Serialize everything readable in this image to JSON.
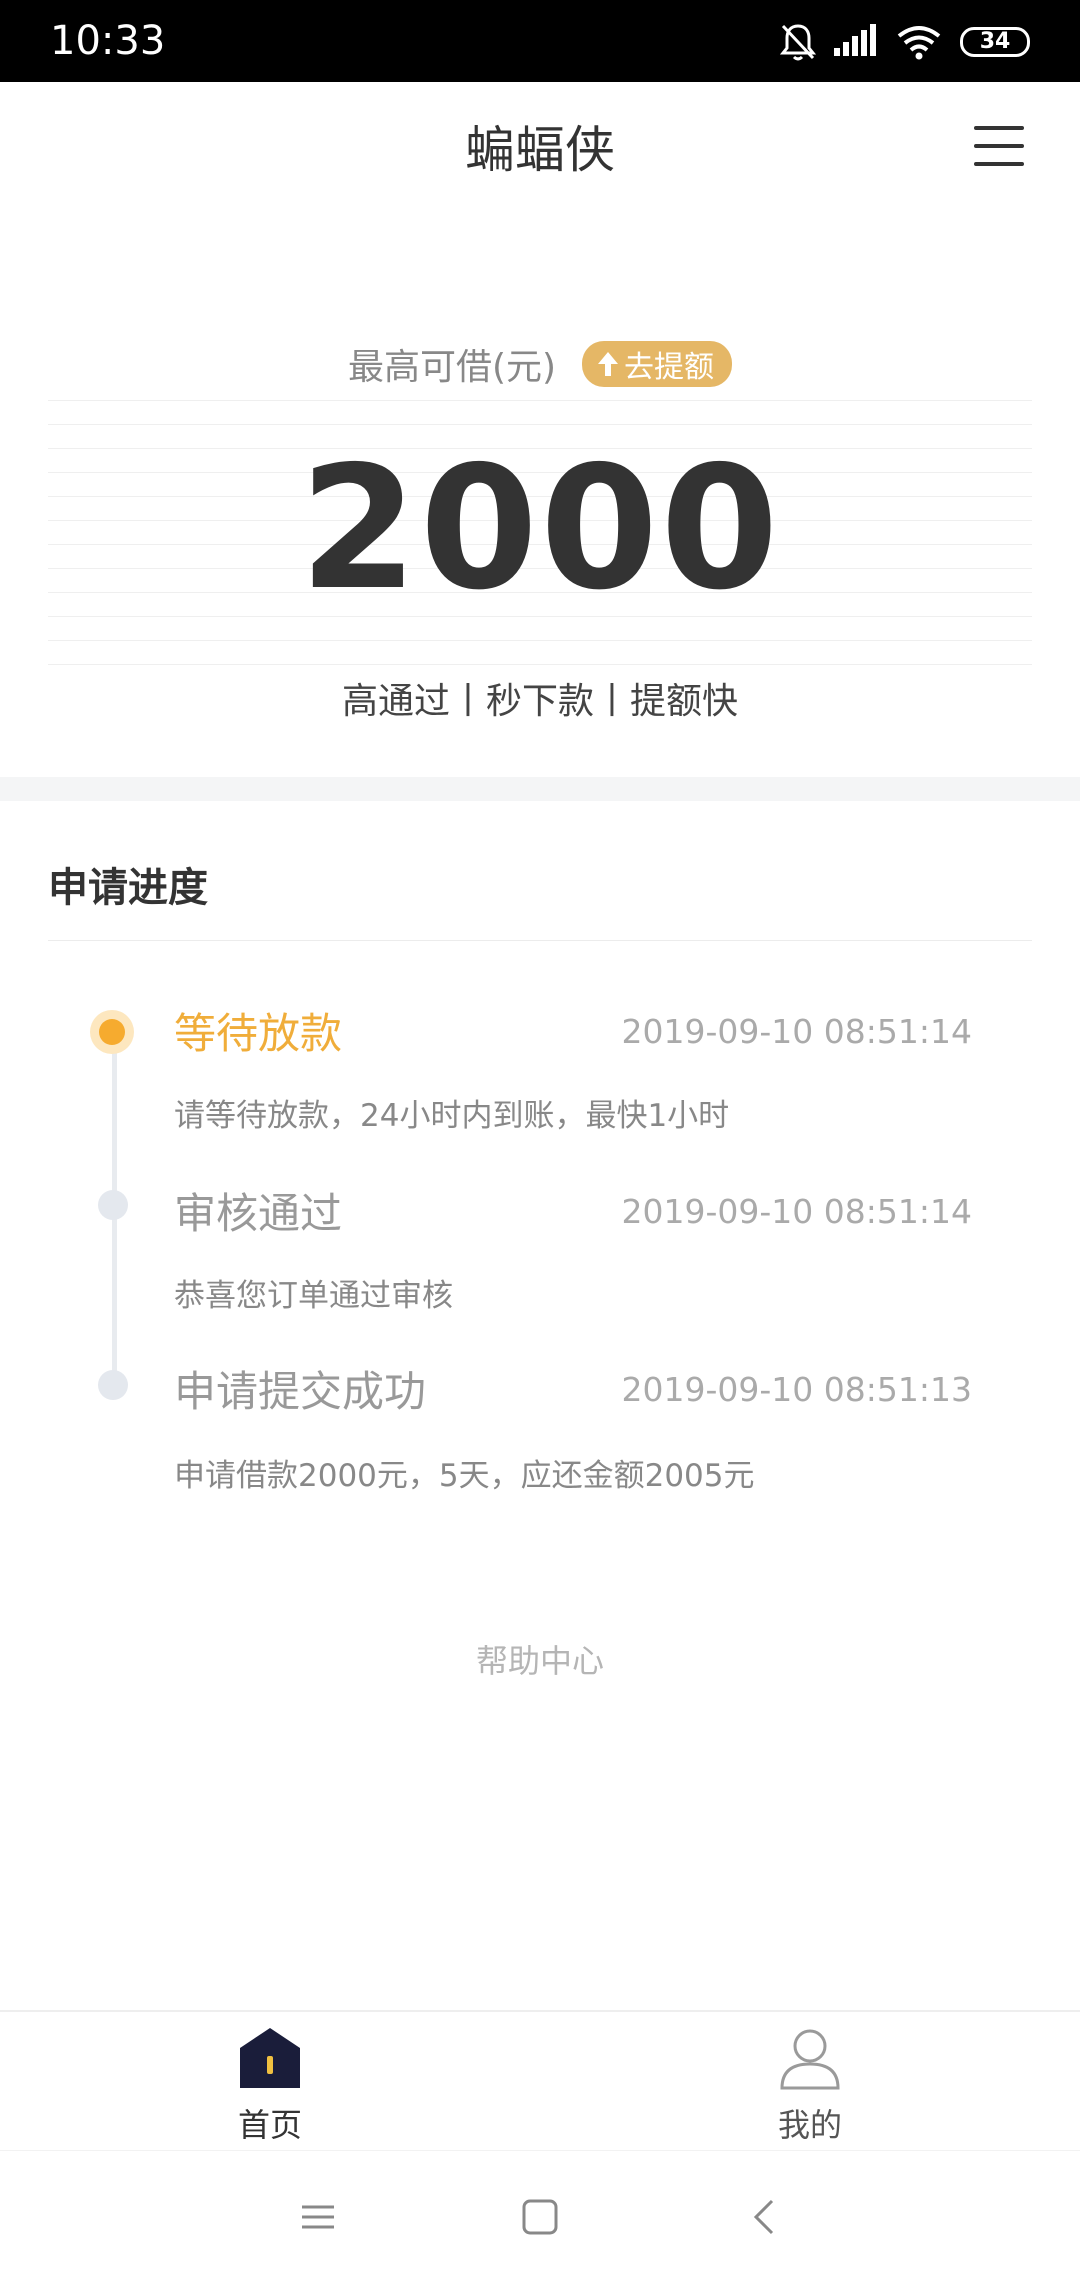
{
  "status_bar": {
    "time": "10:33",
    "battery": "34"
  },
  "header": {
    "title": "蝙蝠侠"
  },
  "credit": {
    "label": "最高可借(元)",
    "badge": "去提额",
    "amount": "2000",
    "features": "高通过丨秒下款丨提额快"
  },
  "progress": {
    "title": "申请进度",
    "steps": [
      {
        "title": "等待放款",
        "time": "2019-09-10 08:51:14",
        "desc": "请等待放款，24小时内到账，最快1小时"
      },
      {
        "title": "审核通过",
        "time": "2019-09-10 08:51:14",
        "desc": "恭喜您订单通过审核"
      },
      {
        "title": "申请提交成功",
        "time": "2019-09-10 08:51:13",
        "desc": "申请借款2000元，5天，应还金额2005元"
      }
    ]
  },
  "help_center": "帮助中心",
  "bottom_nav": [
    {
      "label": "首页",
      "icon": "home-icon"
    },
    {
      "label": "我的",
      "icon": "user-icon"
    }
  ],
  "colors": {
    "accent": "#f0ad3a",
    "badge": "#e5b766",
    "nav_active": "#1a1d3a"
  }
}
